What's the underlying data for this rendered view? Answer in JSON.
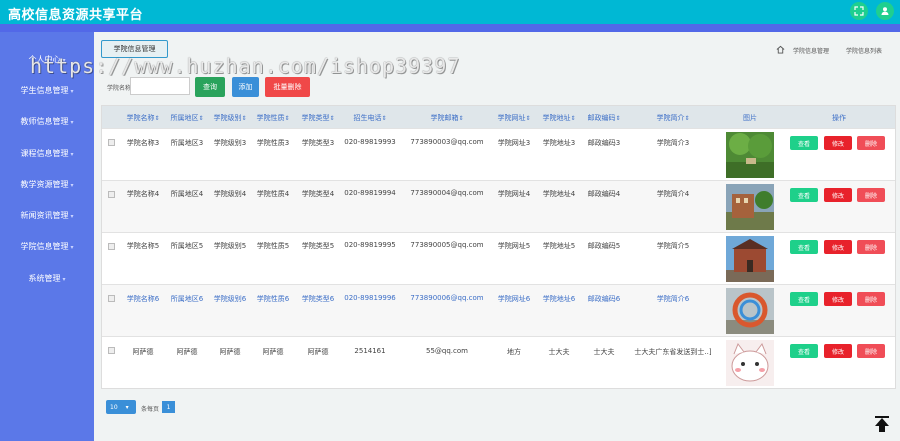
{
  "app": {
    "title": "高校信息资源共享平台"
  },
  "watermark": "https://www.huzhan.com/ishop39397",
  "sidebar": {
    "items": [
      {
        "label": "个人中心"
      },
      {
        "label": "学生信息管理"
      },
      {
        "label": "教师信息管理"
      },
      {
        "label": "课程信息管理"
      },
      {
        "label": "教学资源管理"
      },
      {
        "label": "新闻资讯管理"
      },
      {
        "label": "学院信息管理"
      },
      {
        "label": "系统管理"
      }
    ]
  },
  "tab": {
    "label": "学院信息管理"
  },
  "breadcrumb": {
    "item1": "学院信息管理",
    "item2": "学院信息列表"
  },
  "search": {
    "label": "学院名称",
    "value": "",
    "query_label": "查询",
    "add_label": "添加",
    "batch_delete_label": "批量删除"
  },
  "table": {
    "columns": [
      "学院名称",
      "所属地区",
      "学院级别",
      "学院性质",
      "学院类型",
      "招生电话",
      "学院邮箱",
      "学院网址",
      "学院地址",
      "邮政编码",
      "学院简介",
      "图片",
      "操作"
    ],
    "rows": [
      {
        "name": "学院名称3",
        "region": "所属地区3",
        "level": "学院级别3",
        "nature": "学院性质3",
        "type": "学院类型3",
        "phone": "020-89819993",
        "email": "773890003@qq.com",
        "site": "学院网址3",
        "address": "学院地址3",
        "zip": "邮政编码3",
        "intro": "学院简介3"
      },
      {
        "name": "学院名称4",
        "region": "所属地区4",
        "level": "学院级别4",
        "nature": "学院性质4",
        "type": "学院类型4",
        "phone": "020-89819994",
        "email": "773890004@qq.com",
        "site": "学院网址4",
        "address": "学院地址4",
        "zip": "邮政编码4",
        "intro": "学院简介4"
      },
      {
        "name": "学院名称5",
        "region": "所属地区5",
        "level": "学院级别5",
        "nature": "学院性质5",
        "type": "学院类型5",
        "phone": "020-89819995",
        "email": "773890005@qq.com",
        "site": "学院网址5",
        "address": "学院地址5",
        "zip": "邮政编码5",
        "intro": "学院简介5"
      },
      {
        "name": "学院名称6",
        "region": "所属地区6",
        "level": "学院级别6",
        "nature": "学院性质6",
        "type": "学院类型6",
        "phone": "020-89819996",
        "email": "773890006@qq.com",
        "site": "学院网址6",
        "address": "学院地址6",
        "zip": "邮政编码6",
        "intro": "学院简介6"
      },
      {
        "name": "阿萨德",
        "region": "阿萨德",
        "level": "阿萨德",
        "nature": "阿萨德",
        "type": "阿萨德",
        "phone": "2514161",
        "email": "55@qq.com",
        "site": "地方",
        "address": "士大夫",
        "zip": "士大夫",
        "intro": "士大夫广东省发送到士..]"
      }
    ],
    "actions": {
      "view": "查看",
      "edit": "修改",
      "delete": "删除"
    }
  },
  "pager": {
    "page_size": "10",
    "total_text": "条每页",
    "current_page": "1"
  },
  "colors": {
    "topbar": "#00b8d4",
    "sidebar": "#5b78e8",
    "view": "#1ed08a",
    "edit": "#e8222b",
    "delete": "#f04d57"
  }
}
